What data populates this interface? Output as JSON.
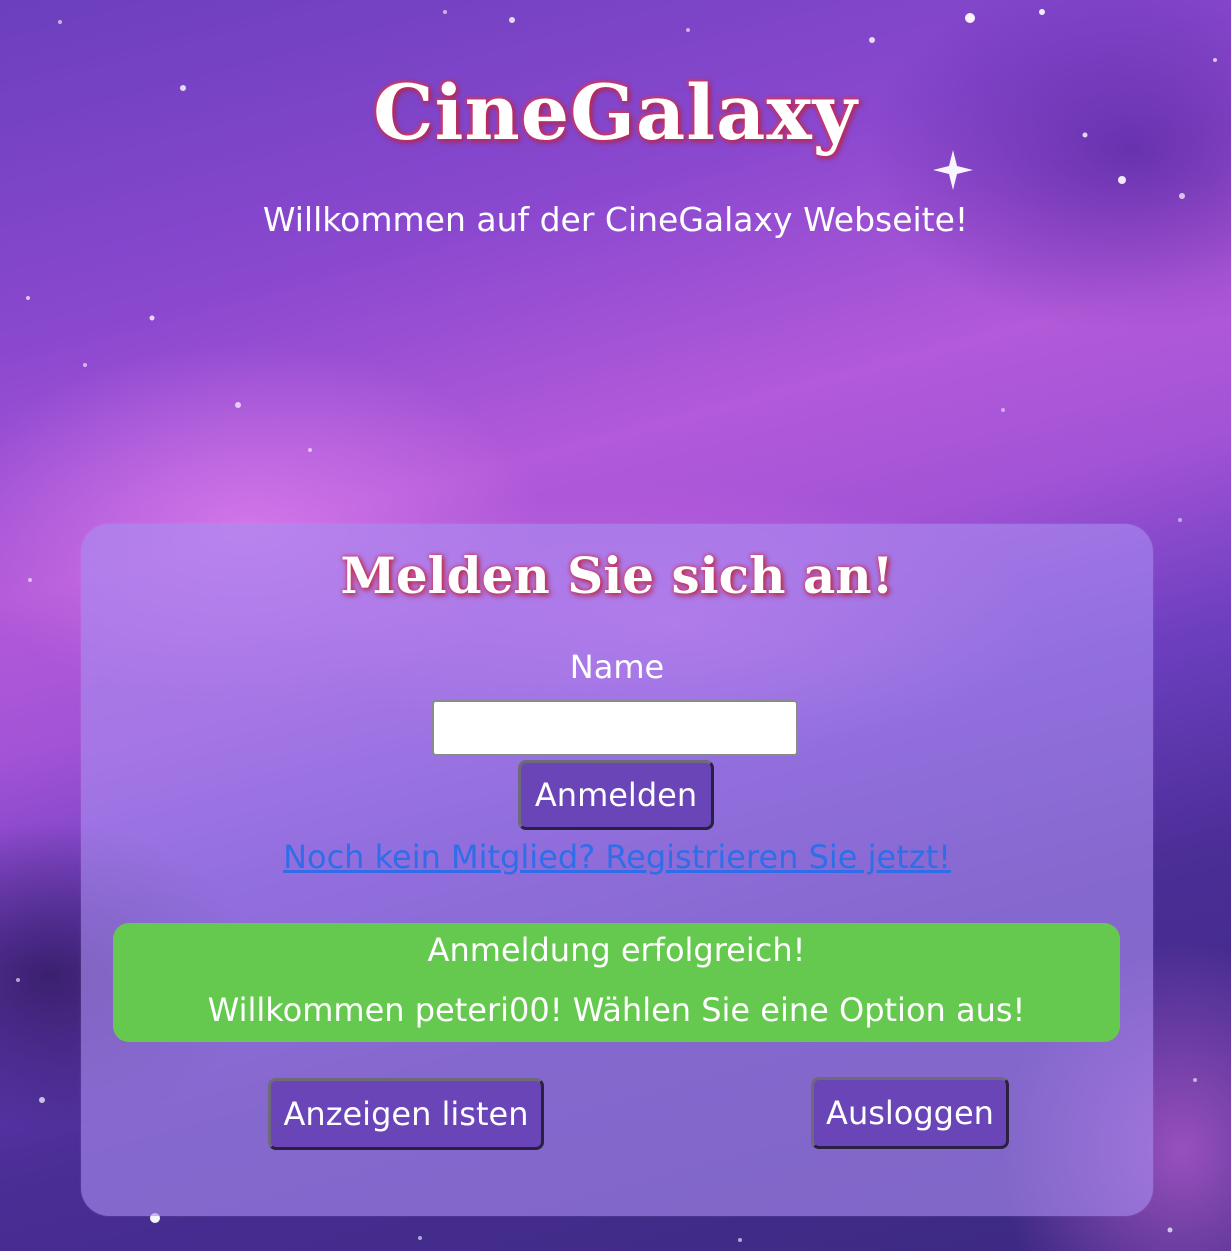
{
  "header": {
    "title": "CineGalaxy",
    "welcome": "Willkommen auf der CineGalaxy Webseite!"
  },
  "login": {
    "heading": "Melden Sie sich an!",
    "name_label": "Name",
    "name_value": "",
    "login_button": "Anmelden",
    "register_link": "Noch kein Mitglied? Registrieren Sie jetzt!"
  },
  "status": {
    "line1": "Anmeldung erfolgreich!",
    "line2": "Willkommen peteri00! Wählen Sie eine Option aus!"
  },
  "actions": {
    "list_ads": "Anzeigen listen",
    "logout": "Ausloggen"
  },
  "colors": {
    "accent_button": "#6a45b8",
    "success": "#66c94f",
    "link": "#2f6ee8",
    "title_glow": "#d8324e"
  }
}
